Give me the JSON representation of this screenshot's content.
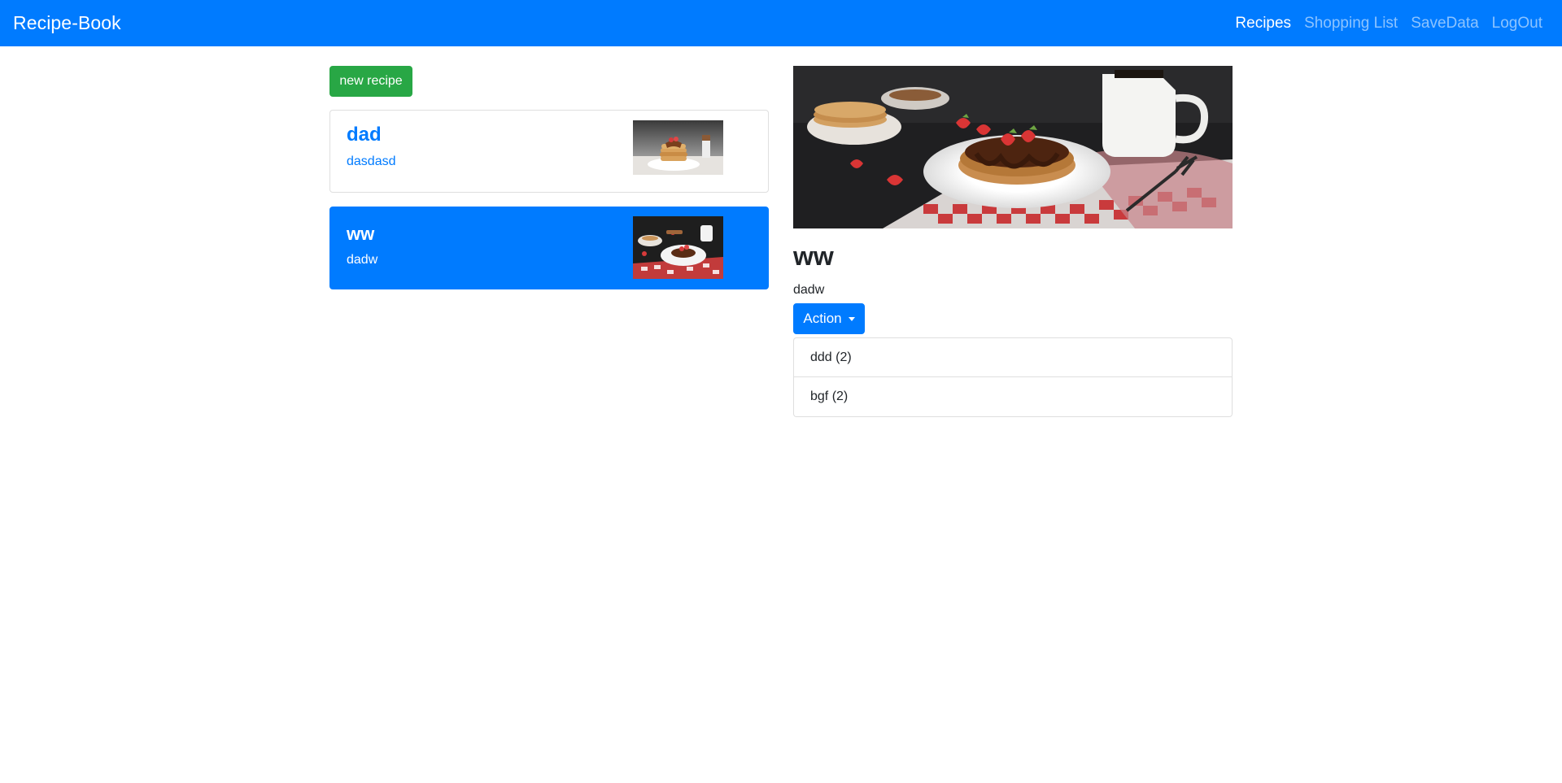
{
  "navbar": {
    "brand": "Recipe-Book",
    "links": [
      {
        "label": "Recipes",
        "active": true
      },
      {
        "label": "Shopping List",
        "active": false
      },
      {
        "label": "SaveData",
        "active": false
      },
      {
        "label": "LogOut",
        "active": false
      }
    ]
  },
  "recipes_panel": {
    "new_recipe_label": "new recipe",
    "items": [
      {
        "name": "dad",
        "description": "dasdasd",
        "active": false,
        "image": "pancake-stack-photo"
      },
      {
        "name": "ww",
        "description": "dadw",
        "active": true,
        "image": "pancakes-strawberries-photo"
      }
    ]
  },
  "detail": {
    "image": "pancakes-strawberries-photo",
    "name": "ww",
    "description": "dadw",
    "action_label": "Action",
    "ingredients": [
      {
        "label": "ddd (2)"
      },
      {
        "label": "bgf (2)"
      }
    ]
  },
  "colors": {
    "primary": "#007bff",
    "success": "#28a745",
    "nav_inactive": "rgba(255,255,255,0.55)"
  }
}
